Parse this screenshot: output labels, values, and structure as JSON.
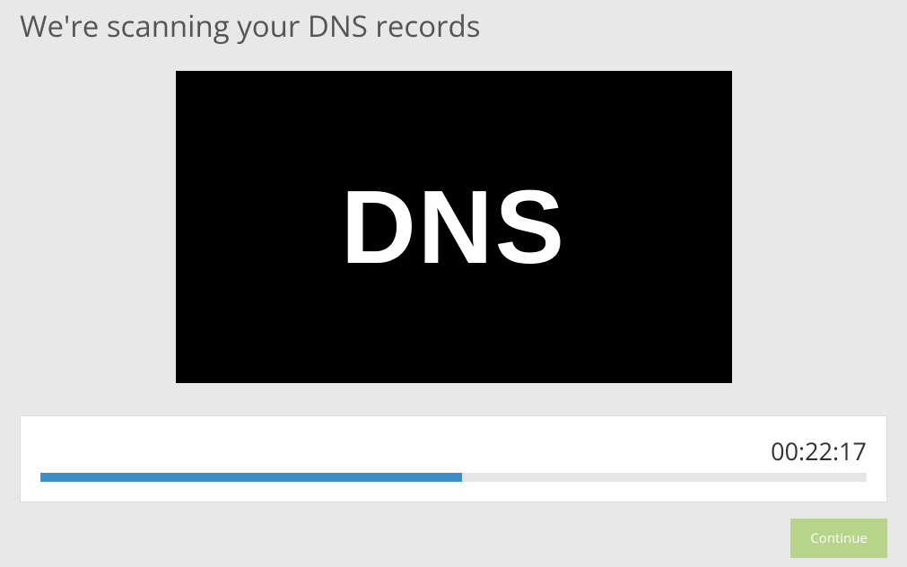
{
  "title": "We're scanning your DNS records",
  "video": {
    "label": "DNS"
  },
  "progress": {
    "timer": "00:22:17",
    "percent": 51,
    "fill_color": "#3d8ec9",
    "track_color": "#e5e5e5"
  },
  "buttons": {
    "continue_label": "Continue"
  }
}
